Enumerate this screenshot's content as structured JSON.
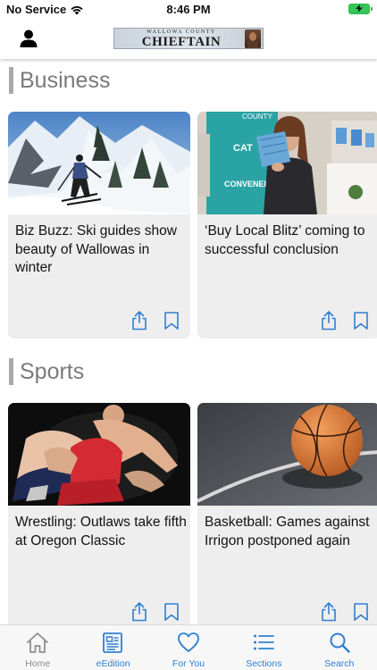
{
  "status_bar": {
    "carrier": "No Service",
    "time": "8:46 PM"
  },
  "header": {
    "masthead_small": "WALLOWA COUNTY",
    "masthead_big": "CHIEFTAIN"
  },
  "sections": [
    {
      "title": "Business",
      "cards": [
        {
          "headline": "Biz Buzz: Ski guides show beauty of Wallowas in winter"
        },
        {
          "headline": "‘Buy Local Blitz’ coming to successful conclusion"
        }
      ]
    },
    {
      "title": "Sports",
      "cards": [
        {
          "headline": "Wrestling: Outlaws take fifth at Oregon Classic"
        },
        {
          "headline": "Basketball: Games against Irrigon postponed again"
        }
      ]
    }
  ],
  "photo_text": {
    "county": "COUNTY",
    "cat": "CAT",
    "convener": "CONVENER"
  },
  "tab_bar": [
    {
      "label": "Home",
      "icon": "home-icon"
    },
    {
      "label": "eEdition",
      "icon": "newspaper-icon"
    },
    {
      "label": "For You",
      "icon": "heart-icon"
    },
    {
      "label": "Sections",
      "icon": "list-icon"
    },
    {
      "label": "Search",
      "icon": "search-icon"
    }
  ],
  "colors": {
    "accent": "#2f7fd3",
    "inactive_tab": "#8e8e93",
    "section_title": "#7a7a7a",
    "card_bg": "#eeeeee",
    "battery": "#34c759"
  }
}
